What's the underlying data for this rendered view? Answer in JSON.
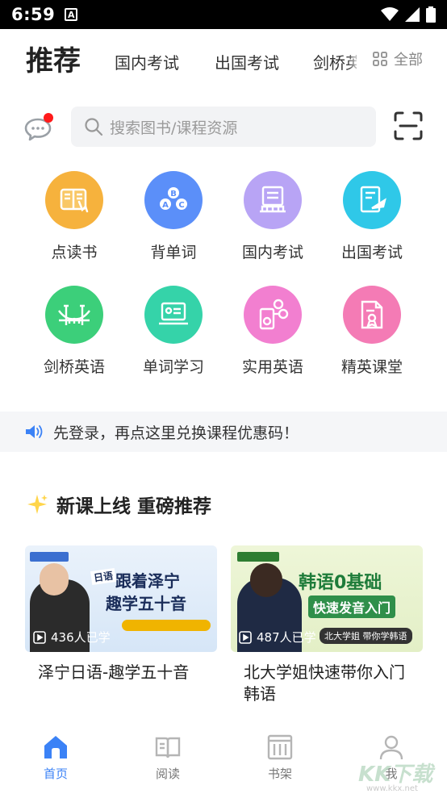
{
  "status_bar": {
    "time": "6:59",
    "notification_badge": "A"
  },
  "top_tabs": {
    "active": "推荐",
    "items": [
      "国内考试",
      "出国考试",
      "剑桥英"
    ],
    "all_label": "全部"
  },
  "search": {
    "placeholder": "搜索图书/课程资源"
  },
  "features": [
    {
      "label": "点读书",
      "icon": "reading-book-icon",
      "color": "#f6b23d"
    },
    {
      "label": "背单词",
      "icon": "abc-words-icon",
      "color": "#5b8ff9"
    },
    {
      "label": "国内考试",
      "icon": "exam-building-icon",
      "color": "#b8a4f5"
    },
    {
      "label": "出国考试",
      "icon": "plane-document-icon",
      "color": "#2fc8e8"
    },
    {
      "label": "剑桥英语",
      "icon": "bridge-icon",
      "color": "#3ccf7a"
    },
    {
      "label": "单词学习",
      "icon": "laptop-card-icon",
      "color": "#35d3a9"
    },
    {
      "label": "实用英语",
      "icon": "music-player-icon",
      "color": "#f27fd0"
    },
    {
      "label": "精英课堂",
      "icon": "certificate-icon",
      "color": "#f47bb5"
    }
  ],
  "notice": {
    "text": "先登录，再点这里兑换课程优惠码！"
  },
  "section": {
    "title": "新课上线 重磅推荐"
  },
  "courses": [
    {
      "title": "泽宁日语-趣学五十音",
      "learners": "436人已学",
      "banner_line1": "跟着泽宁",
      "banner_line2": "趣学五十音",
      "banner_tag": "日语"
    },
    {
      "title": "北大学姐快速带你入门韩语",
      "learners": "487人已学",
      "banner_line1": "韩语0基础",
      "banner_line2": "快速发音入门",
      "banner_tag": "北大学姐 带你学韩语"
    }
  ],
  "tabbar": [
    {
      "label": "首页",
      "icon": "home-icon",
      "active": true
    },
    {
      "label": "阅读",
      "icon": "book-open-icon",
      "active": false
    },
    {
      "label": "书架",
      "icon": "bookshelf-icon",
      "active": false
    },
    {
      "label": "我",
      "icon": "user-icon",
      "active": false
    }
  ],
  "watermark": "KK下载",
  "colors": {
    "accent": "#3b82f6",
    "badge": "#ff1a1a"
  }
}
